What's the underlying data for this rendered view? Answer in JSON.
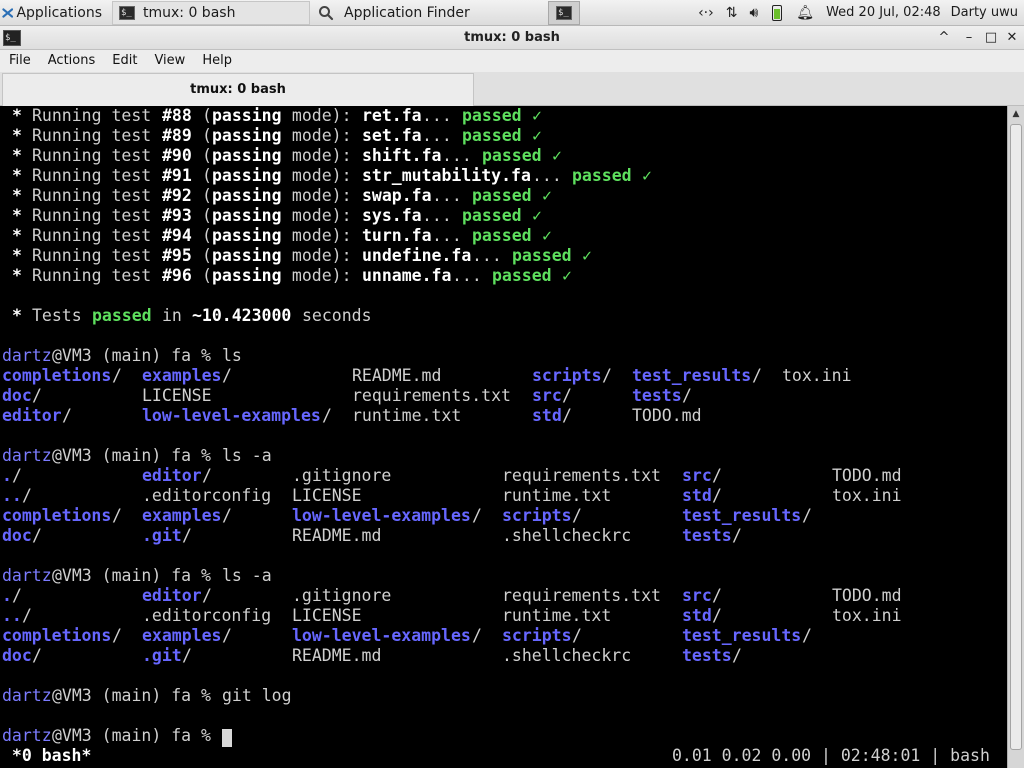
{
  "panel": {
    "apps_label": "Applications",
    "task1": "tmux: 0 bash",
    "task2": "Application Finder",
    "clock": "Wed 20 Jul, 02:48",
    "user": "Darty uwu"
  },
  "window": {
    "title": "tmux: 0 bash",
    "icon_text": "$_"
  },
  "menu": {
    "file": "File",
    "actions": "Actions",
    "edit": "Edit",
    "view": "View",
    "help": "Help"
  },
  "tab": {
    "label": "tmux: 0 bash"
  },
  "terminal": {
    "tests": [
      {
        "n": "#88",
        "file": "ret.fa"
      },
      {
        "n": "#89",
        "file": "set.fa"
      },
      {
        "n": "#90",
        "file": "shift.fa"
      },
      {
        "n": "#91",
        "file": "str_mutability.fa"
      },
      {
        "n": "#92",
        "file": "swap.fa"
      },
      {
        "n": "#93",
        "file": "sys.fa"
      },
      {
        "n": "#94",
        "file": "turn.fa"
      },
      {
        "n": "#95",
        "file": "undefine.fa"
      },
      {
        "n": "#96",
        "file": "unname.fa"
      }
    ],
    "running": "Running test",
    "mode_open": "(",
    "mode_word": "passing",
    "mode_rest": " mode):",
    "dots": "...",
    "passed": "passed",
    "check": "✓",
    "star": "*",
    "summary": {
      "a": "Tests",
      "b": "passed",
      "c": "in",
      "d": "~10.423000",
      "e": "seconds"
    },
    "prompt": {
      "user": "dartz",
      "rest": "@VM3 (main) fa % "
    },
    "cmd_ls": "ls",
    "cmd_lsa": "ls -a",
    "cmd_gitlog": "git log",
    "ls": {
      "completions": "completions",
      "examples": "examples",
      "readme": "README.md",
      "scripts": "scripts",
      "test_results": "test_results",
      "tox": "tox.ini",
      "doc": "doc",
      "license": "LICENSE",
      "requirements": "requirements.txt",
      "src": "src",
      "tests": "tests",
      "editor": "editor",
      "low_level": "low-level-examples",
      "runtime": "runtime.txt",
      "std": "std",
      "todo": "TODO.md"
    },
    "lsa": {
      "dot": ".",
      "dotdot": "..",
      "editor": "editor",
      "editorconfig": ".editorconfig",
      "gitignore": ".gitignore",
      "license": "LICENSE",
      "requirements": "requirements.txt",
      "runtime": "runtime.txt",
      "src": "src",
      "std": "std",
      "todo": "TODO.md",
      "tox": "tox.ini",
      "completions": "completions",
      "examples": "examples",
      "low_level": "low-level-examples",
      "scripts": "scripts",
      "test_results": "test_results",
      "doc": "doc",
      "git": ".git",
      "readme": "README.md",
      "shellcheckrc": ".shellcheckrc",
      "tests": "tests"
    },
    "slash": "/",
    "status": {
      "left": " *0 bash*",
      "right": "0.01 0.02 0.00 | 02:48:01 | bash"
    }
  }
}
